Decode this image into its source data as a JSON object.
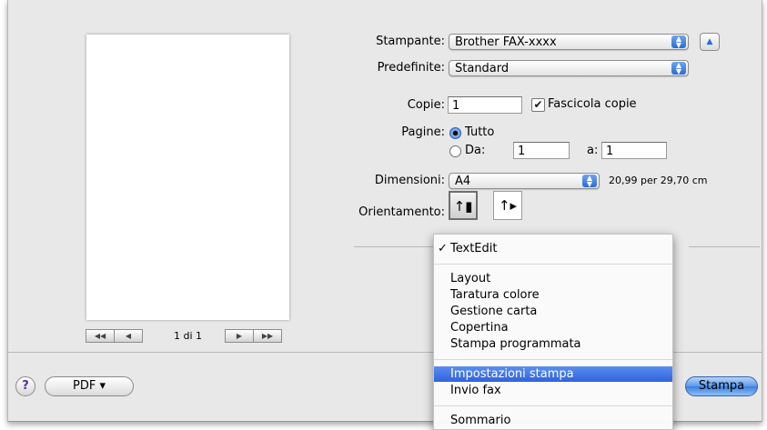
{
  "printer": {
    "label": "Stampante:",
    "value": "Brother FAX-xxxx"
  },
  "presets": {
    "label": "Predefinite:",
    "value": "Standard"
  },
  "copies": {
    "label": "Copie:",
    "value": "1",
    "collate_label": "Fascicola copie",
    "collate_checked": true
  },
  "pages": {
    "label": "Pagine:",
    "all_label": "Tutto",
    "from_label": "Da:",
    "from_value": "1",
    "to_label": "a:",
    "to_value": "1"
  },
  "paper_size": {
    "label": "Dimensioni:",
    "value": "A4",
    "dimensions": "20,99 per 29,70 cm"
  },
  "orientation": {
    "label": "Orientamento:",
    "portrait_icon": "portrait-orientation-icon",
    "landscape_icon": "landscape-orientation-icon"
  },
  "preview": {
    "page_count": "1 di 1",
    "first": "◀◀",
    "prev": "◀",
    "next": "▶",
    "last": "▶▶"
  },
  "menu": {
    "items": [
      {
        "label": "TextEdit",
        "checked": true
      },
      {
        "label": "Layout"
      },
      {
        "label": "Taratura colore"
      },
      {
        "label": "Gestione carta"
      },
      {
        "label": "Copertina"
      },
      {
        "label": "Stampa programmata"
      },
      {
        "label": "Impostazioni stampa",
        "highlighted": true
      },
      {
        "label": "Invio fax"
      },
      {
        "label": "Sommario"
      }
    ],
    "check_mark": "✓"
  },
  "bottom": {
    "help": "?",
    "pdf": "PDF ▾",
    "print": "Stampa"
  },
  "colors": {
    "accent": "#2f63dc",
    "dialog_bg": "#e8e8e8"
  }
}
